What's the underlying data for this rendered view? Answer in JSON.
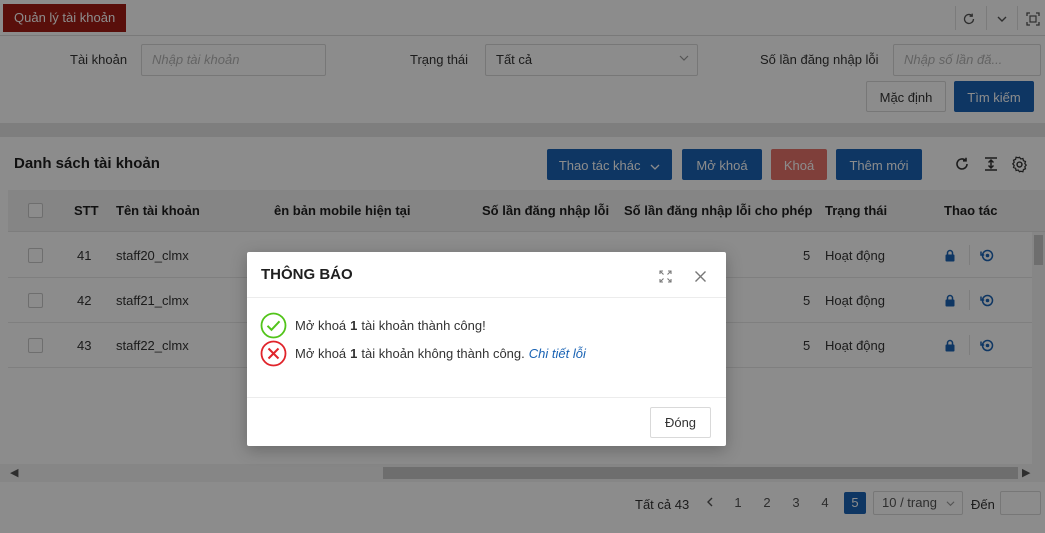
{
  "topbar": {
    "tab_label": "Quản lý tài khoản"
  },
  "filter": {
    "account_label": "Tài khoản",
    "account_placeholder": "Nhập tài khoản",
    "status_label": "Trạng thái",
    "status_value": "Tất cả",
    "failed_login_label": "Số lần đăng nhập lỗi",
    "failed_login_placeholder": "Nhập số lần đă...",
    "reset_button": "Mặc định",
    "search_button": "Tìm kiếm"
  },
  "list": {
    "title": "Danh sách tài khoản",
    "more_actions_button": "Thao tác khác",
    "unlock_button": "Mở khoá",
    "lock_button": "Khoá",
    "add_button": "Thêm mới",
    "columns": [
      "STT",
      "Tên tài khoản",
      "ên bản mobile hiện tại",
      "Số lần đăng nhập lỗi",
      "Số lần đăng nhập lỗi cho phép",
      "Trạng thái",
      "Thao tác"
    ],
    "rows": [
      {
        "stt": "41",
        "account": "staff20_clmx",
        "allowed": "5",
        "status": "Hoạt động"
      },
      {
        "stt": "42",
        "account": "staff21_clmx",
        "allowed": "5",
        "status": "Hoạt động"
      },
      {
        "stt": "43",
        "account": "staff22_clmx",
        "allowed": "5",
        "status": "Hoạt động"
      }
    ]
  },
  "pagination": {
    "total_text": "Tất cả 43",
    "pages": [
      "1",
      "2",
      "3",
      "4",
      "5"
    ],
    "current_page": "5",
    "page_size": "10 / trang",
    "goto_label": "Đến"
  },
  "modal": {
    "title": "THÔNG BÁO",
    "success_prefix": "Mở khoá",
    "success_count": "1",
    "success_suffix": "tài khoản thành công!",
    "fail_prefix": "Mở khoá",
    "fail_count": "1",
    "fail_suffix": "tài khoản không thành công.",
    "fail_link": "Chi tiết lỗi",
    "close_button": "Đóng"
  },
  "colors": {
    "tab_active": "#a31c14",
    "primary": "#1a63b4",
    "danger": "#e8736b",
    "success_icon": "#52c41a",
    "error_icon": "#e0242b"
  },
  "icons": [
    "refresh-icon",
    "chevron-down-icon",
    "fullscreen-icon",
    "column-height-icon",
    "settings-icon",
    "lock-icon",
    "unlock-icon",
    "expand-icon",
    "close-icon",
    "check-circle-icon",
    "close-circle-icon",
    "chevron-left-icon",
    "chevron-right-icon"
  ]
}
